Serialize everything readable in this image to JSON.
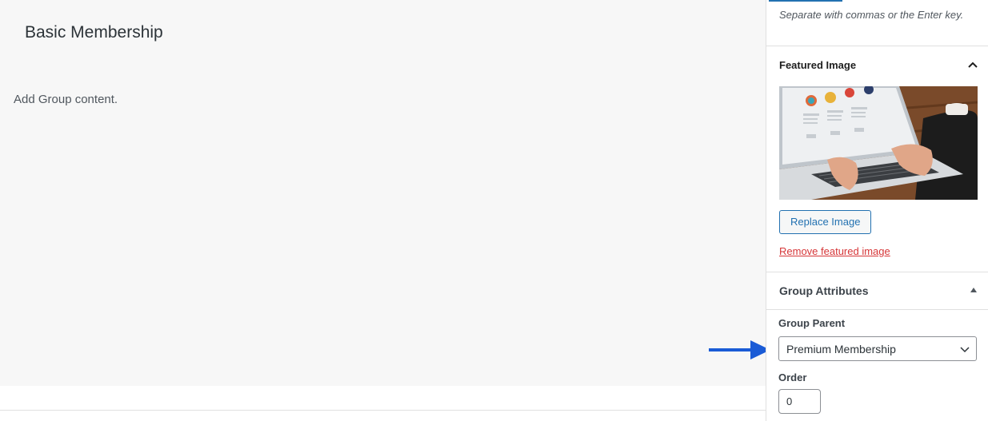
{
  "editor": {
    "title": "Basic Membership",
    "content_placeholder": "Add Group content."
  },
  "sidebar": {
    "tags_hint": "Separate with commas or the Enter key.",
    "featured_image": {
      "title": "Featured Image",
      "toggle_icon": "chevron-up-icon",
      "replace_label": "Replace Image",
      "remove_label": "Remove featured image"
    },
    "group_attributes": {
      "title": "Group Attributes",
      "toggle_icon": "triangle-up-icon",
      "parent_label": "Group Parent",
      "parent_value": "Premium Membership",
      "order_label": "Order",
      "order_value": "0"
    }
  },
  "colors": {
    "accent": "#2271b1",
    "danger": "#d63638",
    "arrow": "#1a5bd6"
  }
}
